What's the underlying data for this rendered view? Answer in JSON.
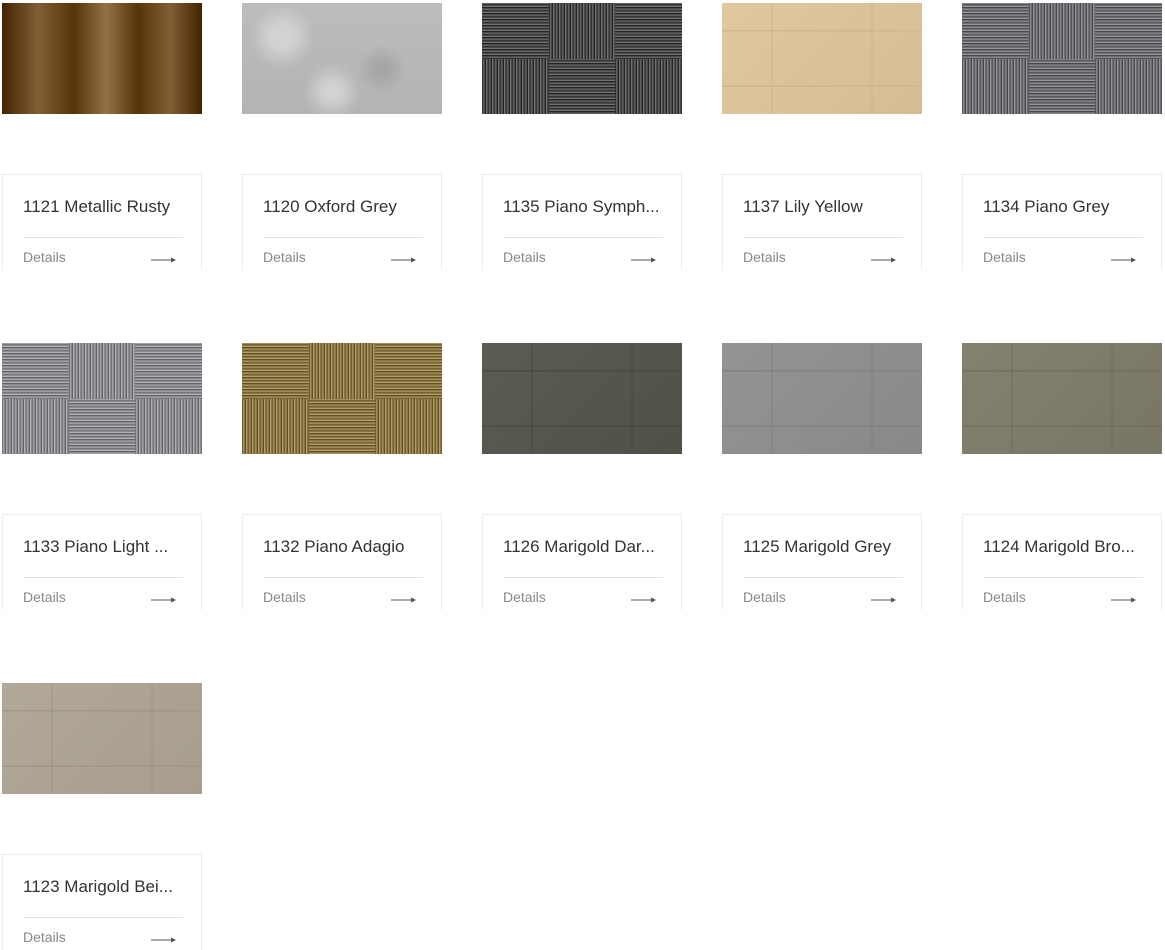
{
  "products": [
    {
      "name": "1121 Metallic Rusty",
      "details_label": "Details",
      "base_color": "#6b4a1f",
      "pattern": "metal",
      "icon": "arrow-right-icon"
    },
    {
      "name": "1120 Oxford Grey",
      "details_label": "Details",
      "base_color": "#bcbcbc",
      "pattern": "concrete",
      "icon": "arrow-right-icon"
    },
    {
      "name": "1135 Piano Symph...",
      "details_label": "Details",
      "base_color": "#4a4a4c",
      "pattern": "stripes-dark",
      "icon": "arrow-right-icon"
    },
    {
      "name": "1137 Lily Yellow",
      "details_label": "Details",
      "base_color": "#dcc299",
      "pattern": "tiles",
      "icon": "arrow-right-icon"
    },
    {
      "name": "1134 Piano Grey",
      "details_label": "Details",
      "base_color": "#6d6e72",
      "pattern": "stripes-grey",
      "icon": "arrow-right-icon"
    },
    {
      "name": "1133 Piano Light ...",
      "details_label": "Details",
      "base_color": "#8a8b8e",
      "pattern": "stripes-light",
      "icon": "arrow-right-icon"
    },
    {
      "name": "1132 Piano Adagio",
      "details_label": "Details",
      "base_color": "#8b7746",
      "pattern": "stripes-olive",
      "icon": "arrow-right-icon"
    },
    {
      "name": "1126 Marigold Dar...",
      "details_label": "Details",
      "base_color": "#55574f",
      "pattern": "tiles",
      "icon": "arrow-right-icon"
    },
    {
      "name": "1125 Marigold Grey",
      "details_label": "Details",
      "base_color": "#8e8e8e",
      "pattern": "tiles",
      "icon": "arrow-right-icon"
    },
    {
      "name": "1124 Marigold Bro...",
      "details_label": "Details",
      "base_color": "#7e7b6a",
      "pattern": "tiles",
      "icon": "arrow-right-icon"
    },
    {
      "name": "1123 Marigold Bei...",
      "details_label": "Details",
      "base_color": "#aca394",
      "pattern": "tiles",
      "icon": "arrow-right-icon"
    }
  ]
}
